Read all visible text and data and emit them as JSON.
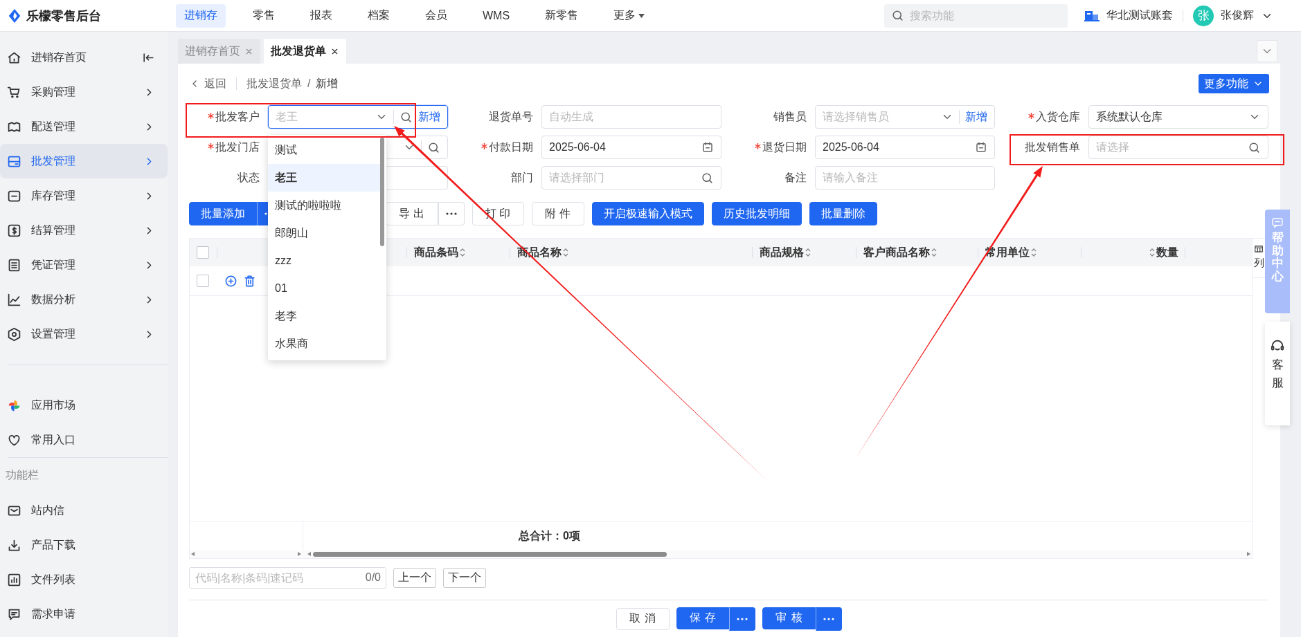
{
  "brand": {
    "name": "乐檬零售后台"
  },
  "nav": [
    {
      "label": "进销存",
      "selected": true,
      "kind": "link"
    },
    {
      "label": "零售",
      "selected": false,
      "kind": "link"
    },
    {
      "label": "报表",
      "selected": false,
      "kind": "link"
    },
    {
      "label": "档案",
      "selected": false,
      "kind": "link"
    },
    {
      "label": "会员",
      "selected": false,
      "kind": "link"
    },
    {
      "label": "WMS",
      "selected": false,
      "kind": "link"
    },
    {
      "label": "新零售",
      "selected": false,
      "kind": "link"
    },
    {
      "label": "更多",
      "selected": false,
      "kind": "menu"
    }
  ],
  "search": {
    "placeholder": "搜索功能"
  },
  "account": {
    "name": "华北测试账套"
  },
  "user": {
    "avatar": "张",
    "name": "张俊辉"
  },
  "sidebar": {
    "items": [
      {
        "label": "进销存首页",
        "selected": false,
        "kind": "home"
      },
      {
        "label": "采购管理",
        "selected": false,
        "kind": "group"
      },
      {
        "label": "配送管理",
        "selected": false,
        "kind": "group"
      },
      {
        "label": "批发管理",
        "selected": true,
        "kind": "group"
      },
      {
        "label": "库存管理",
        "selected": false,
        "kind": "group"
      },
      {
        "label": "结算管理",
        "selected": false,
        "kind": "group"
      },
      {
        "label": "凭证管理",
        "selected": false,
        "kind": "group"
      },
      {
        "label": "数据分析",
        "selected": false,
        "kind": "group"
      },
      {
        "label": "设置管理",
        "selected": false,
        "kind": "group"
      }
    ],
    "apps": [
      {
        "label": "应用市场"
      },
      {
        "label": "常用入口"
      }
    ],
    "section_label": "功能栏",
    "tools": [
      {
        "label": "站内信"
      },
      {
        "label": "产品下载"
      },
      {
        "label": "文件列表"
      },
      {
        "label": "需求申请"
      }
    ]
  },
  "tabs": [
    {
      "label": "进销存首页",
      "selected": false
    },
    {
      "label": "批发退货单",
      "selected": true
    }
  ],
  "breadcrumb": {
    "back": "返回",
    "items": [
      "批发退货单",
      "新增"
    ],
    "separator": "/"
  },
  "more_functions": "更多功能",
  "form": {
    "fields": [
      {
        "label": "批发客户",
        "required": true,
        "kind": "select_search",
        "placeholder": "老王",
        "link": "新增",
        "focused": true
      },
      {
        "label": "退货单号",
        "required": false,
        "kind": "input",
        "placeholder": "自动生成",
        "focused": false
      },
      {
        "label": "销售员",
        "required": false,
        "kind": "select",
        "placeholder": "请选择销售员",
        "link": "新增",
        "focused": false
      },
      {
        "label": "入货仓库",
        "required": true,
        "kind": "select",
        "value": "系统默认仓库",
        "focused": false
      },
      {
        "label": "批发门店",
        "required": true,
        "kind": "select_search",
        "focused": false
      },
      {
        "label": "付款日期",
        "required": true,
        "kind": "date",
        "value": "2025-06-04",
        "focused": false
      },
      {
        "label": "退货日期",
        "required": true,
        "kind": "date",
        "value": "2025-06-04",
        "focused": false
      },
      {
        "label": "批发销售单",
        "required": false,
        "kind": "search",
        "placeholder": "请选择",
        "focused": false
      },
      {
        "label": "状态",
        "required": false,
        "kind": "input",
        "focused": false
      },
      {
        "label": "部门",
        "required": false,
        "kind": "search",
        "placeholder": "请选择部门",
        "focused": false
      },
      {
        "label": "备注",
        "required": false,
        "kind": "input",
        "placeholder": "请输入备注",
        "focused": false
      }
    ]
  },
  "customer_dropdown": {
    "options": [
      {
        "label": "测试",
        "selected": false
      },
      {
        "label": "老王",
        "selected": true
      },
      {
        "label": "测试的啦啦啦",
        "selected": false
      },
      {
        "label": "郎朗山",
        "selected": false
      },
      {
        "label": "zzz",
        "selected": false
      },
      {
        "label": "01",
        "selected": false
      },
      {
        "label": "老李",
        "selected": false
      },
      {
        "label": "水果商",
        "selected": false
      }
    ]
  },
  "toolbar": [
    {
      "label": "批量添加",
      "kind": "primary",
      "disabled": false,
      "more": true
    },
    {
      "label": "导出",
      "kind": "default",
      "disabled": true,
      "more": true
    },
    {
      "label": "打印",
      "kind": "default",
      "disabled": true,
      "more": false
    },
    {
      "label": "附件",
      "kind": "default",
      "disabled": true,
      "more": false
    },
    {
      "label": "开启极速输入模式",
      "kind": "primary",
      "disabled": false,
      "more": false
    },
    {
      "label": "历史批发明细",
      "kind": "primary",
      "disabled": false,
      "more": false
    },
    {
      "label": "批量删除",
      "kind": "primary",
      "disabled": false,
      "more": false
    }
  ],
  "table": {
    "header_checked": false,
    "columns": [
      {
        "label": "商品条码",
        "sortable": true
      },
      {
        "label": "商品名称",
        "sortable": true
      },
      {
        "label": "商品规格",
        "sortable": true
      },
      {
        "label": "客户商品名称",
        "sortable": true
      },
      {
        "label": "常用单位",
        "sortable": true
      },
      {
        "label": "数量",
        "sortable": true
      }
    ],
    "rows": [
      {
        "checked": false
      }
    ],
    "total": "总合计：0项",
    "column_settings": "列"
  },
  "finder": {
    "placeholder": "代码|名称|条码|速记码",
    "count": "0/0",
    "prev": "上一个",
    "next": "下一个"
  },
  "footer": [
    {
      "label": "取消",
      "kind": "default",
      "more": false
    },
    {
      "label": "保存",
      "kind": "primary",
      "more": true
    },
    {
      "label": "审核",
      "kind": "primary",
      "more": true
    }
  ],
  "side_panel": {
    "help": "帮助中心",
    "service": "客服"
  }
}
